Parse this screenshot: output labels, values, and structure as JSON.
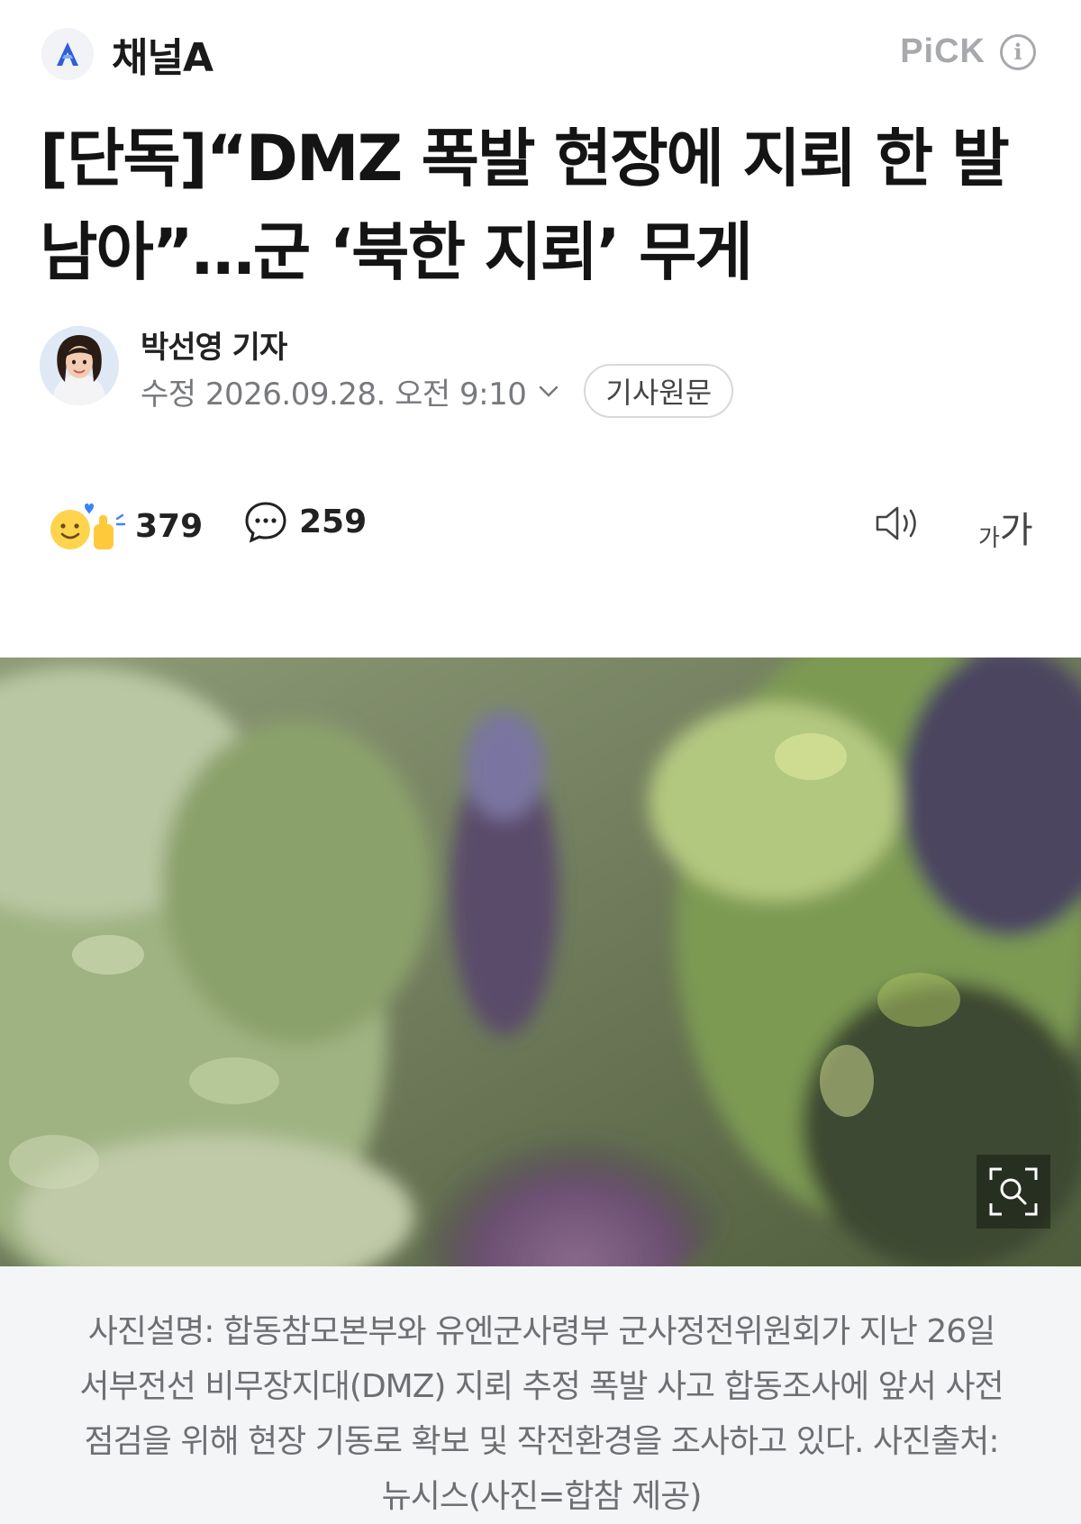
{
  "header": {
    "logo_letter": "A",
    "brand_name": "채널A",
    "pick_label": "PiCK",
    "info_glyph": "i"
  },
  "article": {
    "title": "[단독]“DMZ 폭발 현장에 지뢰 한 발 남아”…군 ‘북한 지뢰’ 무게",
    "reporter": "박선영 기자",
    "date": "수정 2026.09.28. 오전 9:10",
    "original_button": "기사원문"
  },
  "actions": {
    "reaction_count": "379",
    "comment_count": "259",
    "font_small": "가",
    "font_big": "가"
  },
  "photo": {
    "caption": "사진설명: 합동참모본부와 유엔군사령부 군사정전위원회가 지난 26일 서부전선 비무장지대(DMZ) 지뢰 추정 폭발 사고 합동조사에 앞서 사전 점검을 위해 현장 기동로 확보 및 작전환경을 조사하고 있다. 사진출처: 뉴시스(사진=합참 제공)"
  },
  "colors": {
    "accent_logo": "#2f5fd7",
    "muted_text": "#77797d",
    "caption_bg": "#f4f5f7"
  },
  "icons": [
    "channel-a-logo-icon",
    "info-icon",
    "chevron-down-icon",
    "reaction-emoji-icon",
    "comment-bubble-icon",
    "speaker-icon",
    "font-size-icon",
    "zoom-icon"
  ]
}
